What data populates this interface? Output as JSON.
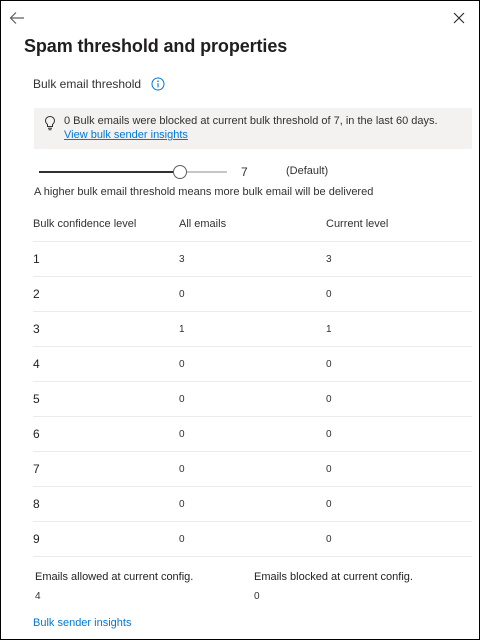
{
  "header": {
    "title": "Spam threshold and properties",
    "back_icon": "arrow-left-icon",
    "close_icon": "close-icon"
  },
  "threshold": {
    "label": "Bulk email threshold",
    "banner_text": "0 Bulk emails were blocked at current bulk threshold of 7, in the last 60 days.",
    "banner_link": "View bulk sender insights",
    "slider_value": "7",
    "slider_fraction": 0.75,
    "slider_default": "(Default)",
    "hint": "A higher bulk email threshold means more bulk email will be delivered"
  },
  "table": {
    "headers": [
      "Bulk confidence level",
      "All emails",
      "Current level"
    ],
    "rows": [
      [
        "1",
        "3",
        "3"
      ],
      [
        "2",
        "0",
        "0"
      ],
      [
        "3",
        "1",
        "1"
      ],
      [
        "4",
        "0",
        "0"
      ],
      [
        "5",
        "0",
        "0"
      ],
      [
        "6",
        "0",
        "0"
      ],
      [
        "7",
        "0",
        "0"
      ],
      [
        "8",
        "0",
        "0"
      ],
      [
        "9",
        "0",
        "0"
      ]
    ]
  },
  "summary": {
    "allowed_label": "Emails allowed at current config.",
    "allowed_value": "4",
    "blocked_label": "Emails blocked at current config.",
    "blocked_value": "0"
  },
  "footer": {
    "link": "Bulk sender insights"
  },
  "colors": {
    "accent": "#0078d4",
    "banner_bg": "#f3f2f1",
    "divider": "#edebe9"
  }
}
